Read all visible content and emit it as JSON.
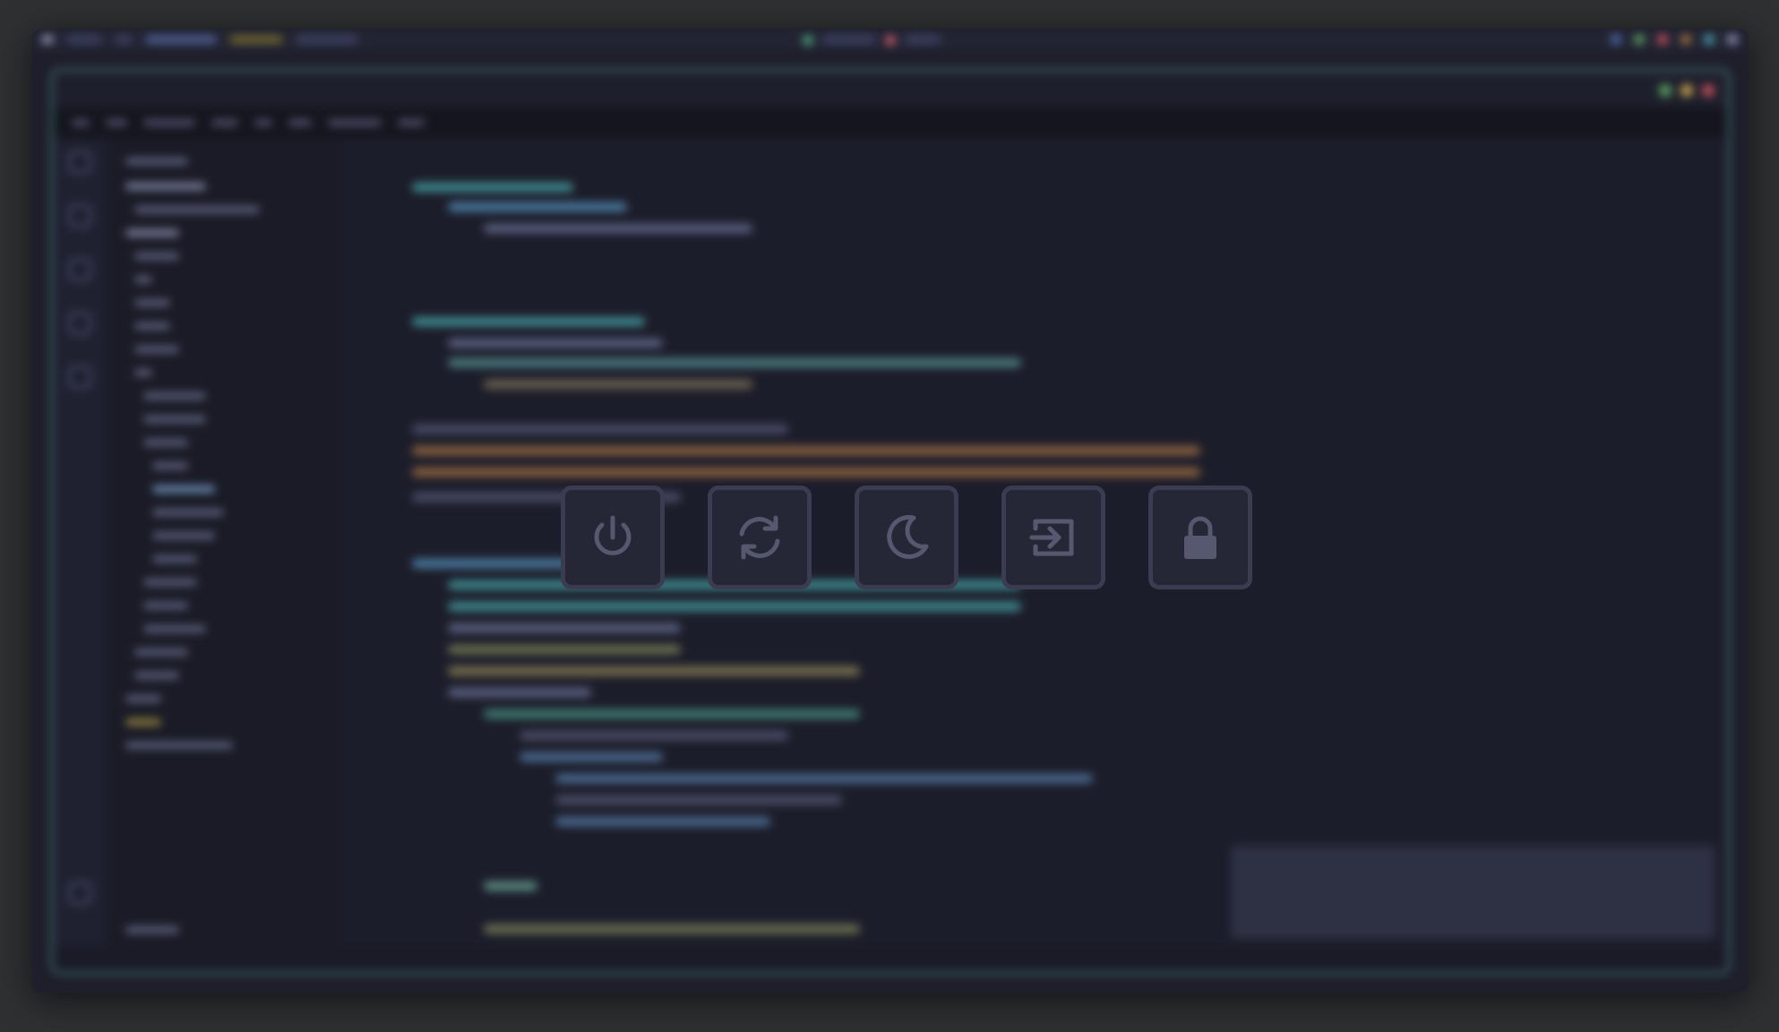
{
  "colors": {
    "desktop_bg": "#2f3032",
    "editor_bg": "#1c1d2a",
    "editor_border": "#3a5c61",
    "button_bg": "#252636",
    "button_border": "#3a3d52",
    "icon": "#55586f"
  },
  "power_menu": {
    "buttons": [
      {
        "icon": "power-icon",
        "action": "shutdown"
      },
      {
        "icon": "refresh-icon",
        "action": "reboot"
      },
      {
        "icon": "moon-icon",
        "action": "suspend"
      },
      {
        "icon": "logout-icon",
        "action": "logout"
      },
      {
        "icon": "lock-icon",
        "action": "lock"
      }
    ]
  },
  "background": {
    "state": "blurred",
    "app": "code-editor"
  }
}
